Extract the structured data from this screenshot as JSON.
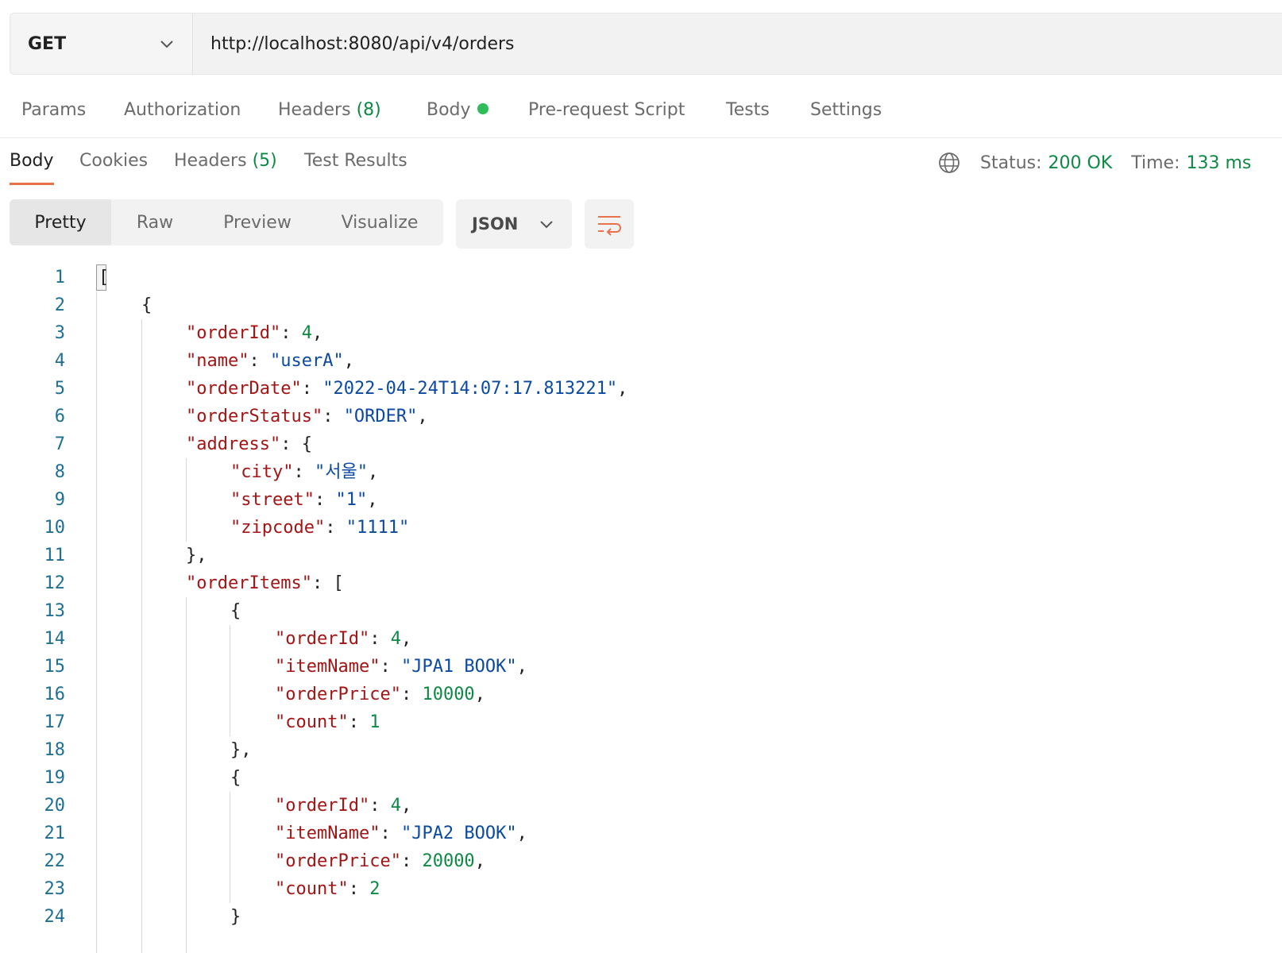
{
  "request": {
    "method": "GET",
    "url": "http://localhost:8080/api/v4/orders"
  },
  "request_tabs": [
    {
      "label": "Params"
    },
    {
      "label": "Authorization"
    },
    {
      "label": "Headers",
      "count": "(8)"
    },
    {
      "label": "Body"
    },
    {
      "label": "Pre-request Script"
    },
    {
      "label": "Tests"
    },
    {
      "label": "Settings"
    }
  ],
  "response_tabs": [
    {
      "label": "Body"
    },
    {
      "label": "Cookies"
    },
    {
      "label": "Headers",
      "count": "(5)"
    },
    {
      "label": "Test Results"
    }
  ],
  "response_status": {
    "status_label": "Status:",
    "status_value": "200 OK",
    "time_label": "Time:",
    "time_value": "133 ms"
  },
  "view_modes": [
    "Pretty",
    "Raw",
    "Preview",
    "Visualize"
  ],
  "format": "JSON",
  "icons": {
    "method_dropdown": "chevron-down-icon",
    "globe": "globe-icon",
    "format_dropdown": "chevron-down-icon",
    "wrap": "wrap-lines-icon"
  },
  "colors": {
    "accent": "#e8714a",
    "status_green": "#0c8a44",
    "body_dot": "#2ebd59",
    "json_key": "#a31515",
    "json_string": "#0b4aa2",
    "json_number": "#0c8a44",
    "line_number": "#1f6f92"
  },
  "code_lines": [
    {
      "n": "1",
      "indent": 0,
      "tokens": [
        [
          "p",
          "["
        ]
      ]
    },
    {
      "n": "2",
      "indent": 1,
      "tokens": [
        [
          "p",
          "{"
        ]
      ]
    },
    {
      "n": "3",
      "indent": 2,
      "tokens": [
        [
          "k",
          "\"orderId\""
        ],
        [
          "p",
          ": "
        ],
        [
          "n",
          "4"
        ],
        [
          "p",
          ","
        ]
      ]
    },
    {
      "n": "4",
      "indent": 2,
      "tokens": [
        [
          "k",
          "\"name\""
        ],
        [
          "p",
          ": "
        ],
        [
          "s",
          "\"userA\""
        ],
        [
          "p",
          ","
        ]
      ]
    },
    {
      "n": "5",
      "indent": 2,
      "tokens": [
        [
          "k",
          "\"orderDate\""
        ],
        [
          "p",
          ": "
        ],
        [
          "s",
          "\"2022-04-24T14:07:17.813221\""
        ],
        [
          "p",
          ","
        ]
      ]
    },
    {
      "n": "6",
      "indent": 2,
      "tokens": [
        [
          "k",
          "\"orderStatus\""
        ],
        [
          "p",
          ": "
        ],
        [
          "s",
          "\"ORDER\""
        ],
        [
          "p",
          ","
        ]
      ]
    },
    {
      "n": "7",
      "indent": 2,
      "tokens": [
        [
          "k",
          "\"address\""
        ],
        [
          "p",
          ": {"
        ]
      ]
    },
    {
      "n": "8",
      "indent": 3,
      "tokens": [
        [
          "k",
          "\"city\""
        ],
        [
          "p",
          ": "
        ],
        [
          "s",
          "\"서울\""
        ],
        [
          "p",
          ","
        ]
      ]
    },
    {
      "n": "9",
      "indent": 3,
      "tokens": [
        [
          "k",
          "\"street\""
        ],
        [
          "p",
          ": "
        ],
        [
          "s",
          "\"1\""
        ],
        [
          "p",
          ","
        ]
      ]
    },
    {
      "n": "10",
      "indent": 3,
      "tokens": [
        [
          "k",
          "\"zipcode\""
        ],
        [
          "p",
          ": "
        ],
        [
          "s",
          "\"1111\""
        ]
      ]
    },
    {
      "n": "11",
      "indent": 2,
      "tokens": [
        [
          "p",
          "},"
        ]
      ]
    },
    {
      "n": "12",
      "indent": 2,
      "tokens": [
        [
          "k",
          "\"orderItems\""
        ],
        [
          "p",
          ": ["
        ]
      ]
    },
    {
      "n": "13",
      "indent": 3,
      "tokens": [
        [
          "p",
          "{"
        ]
      ]
    },
    {
      "n": "14",
      "indent": 4,
      "tokens": [
        [
          "k",
          "\"orderId\""
        ],
        [
          "p",
          ": "
        ],
        [
          "n",
          "4"
        ],
        [
          "p",
          ","
        ]
      ]
    },
    {
      "n": "15",
      "indent": 4,
      "tokens": [
        [
          "k",
          "\"itemName\""
        ],
        [
          "p",
          ": "
        ],
        [
          "s",
          "\"JPA1 BOOK\""
        ],
        [
          "p",
          ","
        ]
      ]
    },
    {
      "n": "16",
      "indent": 4,
      "tokens": [
        [
          "k",
          "\"orderPrice\""
        ],
        [
          "p",
          ": "
        ],
        [
          "n",
          "10000"
        ],
        [
          "p",
          ","
        ]
      ]
    },
    {
      "n": "17",
      "indent": 4,
      "tokens": [
        [
          "k",
          "\"count\""
        ],
        [
          "p",
          ": "
        ],
        [
          "n",
          "1"
        ]
      ]
    },
    {
      "n": "18",
      "indent": 3,
      "tokens": [
        [
          "p",
          "},"
        ]
      ]
    },
    {
      "n": "19",
      "indent": 3,
      "tokens": [
        [
          "p",
          "{"
        ]
      ]
    },
    {
      "n": "20",
      "indent": 4,
      "tokens": [
        [
          "k",
          "\"orderId\""
        ],
        [
          "p",
          ": "
        ],
        [
          "n",
          "4"
        ],
        [
          "p",
          ","
        ]
      ]
    },
    {
      "n": "21",
      "indent": 4,
      "tokens": [
        [
          "k",
          "\"itemName\""
        ],
        [
          "p",
          ": "
        ],
        [
          "s",
          "\"JPA2 BOOK\""
        ],
        [
          "p",
          ","
        ]
      ]
    },
    {
      "n": "22",
      "indent": 4,
      "tokens": [
        [
          "k",
          "\"orderPrice\""
        ],
        [
          "p",
          ": "
        ],
        [
          "n",
          "20000"
        ],
        [
          "p",
          ","
        ]
      ]
    },
    {
      "n": "23",
      "indent": 4,
      "tokens": [
        [
          "k",
          "\"count\""
        ],
        [
          "p",
          ": "
        ],
        [
          "n",
          "2"
        ]
      ]
    },
    {
      "n": "24",
      "indent": 3,
      "tokens": [
        [
          "p",
          "}"
        ]
      ]
    }
  ]
}
